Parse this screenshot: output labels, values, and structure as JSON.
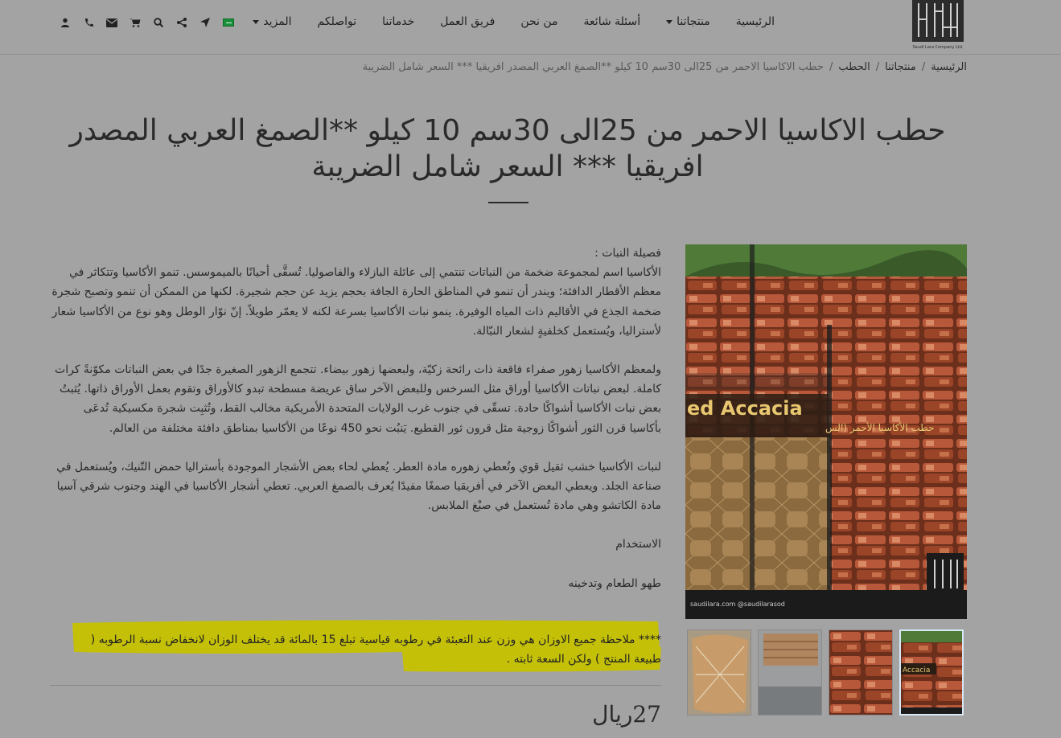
{
  "header": {
    "logo_label": "Saudi Lara Company Ltd.",
    "nav": [
      {
        "label": "الرئيسية",
        "has_dropdown": false
      },
      {
        "label": "منتجاتنا",
        "has_dropdown": true
      },
      {
        "label": "أسئلة شائعة",
        "has_dropdown": false
      },
      {
        "label": "من نحن",
        "has_dropdown": false
      },
      {
        "label": "فريق العمل",
        "has_dropdown": false
      },
      {
        "label": "خدماتنا",
        "has_dropdown": false
      },
      {
        "label": "تواصلكم",
        "has_dropdown": false
      },
      {
        "label": "المزيد",
        "has_dropdown": true
      }
    ],
    "icons": [
      "user-icon",
      "phone-icon",
      "envelope-icon",
      "cart-icon",
      "search-icon",
      "share-icon",
      "location-arrow-icon",
      "saudi-flag-icon"
    ]
  },
  "breadcrumb": {
    "items": [
      "الرئيسية",
      "منتجاتنا",
      "الحطب"
    ],
    "current": "حطب الاكاسيا الاحمر من 25الى 30سم 10 كيلو **الصمغ العربي المصدر افريقيا *** السعر شامل الضريبة"
  },
  "product": {
    "title": "حطب الاكاسيا الاحمر من 25الى 30سم 10 كيلو **الصمغ العربي المصدر افريقيا *** السعر شامل الضريبة",
    "description": [
      "فصيلة النبات :",
      "الأكاسيا اسم لمجموعة ضخمة من النباتات تنتمي إلى عائلة البازلاء والفاصوليا. تُسقَّى أحيانًا بالميموسس. تنمو الأكاسيا وتتكاثر في معظم الأقطار الدافئة؛ ويندر أن تنمو في المناطق الحارة الجافة بحجم يزيد عن حجم شجيرة. لكنها من الممكن أن تنمو وتصبح شجرة ضخمة الجذع في الأقاليم ذات المياه الوفيرة. ينمو نبات الأكاسيا بسرعة لكنه لا يعمّر طويلاً. إنّ نوّار الوطل وهو نوع من الأكاسيا شعار لأستراليا، ويُستعمل كخلفيةٍ لشعار النبّالة.",
      "",
      "ولمعظم الأكاسيا زهور صفراء فاقعة ذات رائحة زكيّة، ولبعضها زهور بيضاء. تتجمع الزهور الصغيرة جدًا في بعض النباتات مكوّنةً كرات كاملة. لبعض نباتات الأكاسيا أوراق مثل السرخس وللبعض الآخر ساق عريضة مسطحة تبدو كالأوراق وتقوم بعمل الأوراق ذاتها. يُثبتُ بعض نبات الأكاسيا أشواكًا حادة. تسقّى في جنوب غرب الولايات المتحدة الأمريكية مخالب القط، وتُثبِت شجرة مكسيكية تُدعَى بأكاسيا قرن الثور أشواكًا زوجية مثل قرون ثور القطيع. يَنبُت نحو 450 نوعًا من الأكاسيا بمناطق دافئة مختلفة من العالم.",
      "",
      "لنبات الأكاسيا خشب ثقيل قوي وتُعطي زهوره مادة العطر. يُعطي لحاء بعض الأشجار الموجودة بأستراليا حمض التّنيك، ويُستعمل في صناعة الجلد. ويعطي البعض الآخر في أفريقيا صمغًا مفيدًا يُعرف بالصمغ العربي. تعطي أشجار الأكاسيا في الهند وجنوب شرقي آسيا مادة الكاتشو وهي مادة تُستعمل في صبْغ الملابس.",
      "",
      "الاستخدام",
      "",
      "طهو الطعام وتدخينه"
    ],
    "note": "**** ملاحظة جميع الاوزان هي وزن عند التعبئة في رطوبه قياسية تبلغ 15 بالمائة قد يختلف الوزان لانخفاض نسبة الرطوبه ( طبيعة المنتج ) ولكن السعة ثابته .",
    "price": "27ريال"
  },
  "gallery": {
    "main_image_caption_en": "ed Accacia",
    "main_image_caption_ar": "حطب الأكاسيا الأحمر (الس",
    "main_image_footer": "saudilara.com  @saudilarasod",
    "selected_thumb": 3,
    "thumb_count": 4
  },
  "colors": {
    "background": "#a3a3a3",
    "highlight": "#c6c200",
    "text": "#2a2a2a"
  }
}
